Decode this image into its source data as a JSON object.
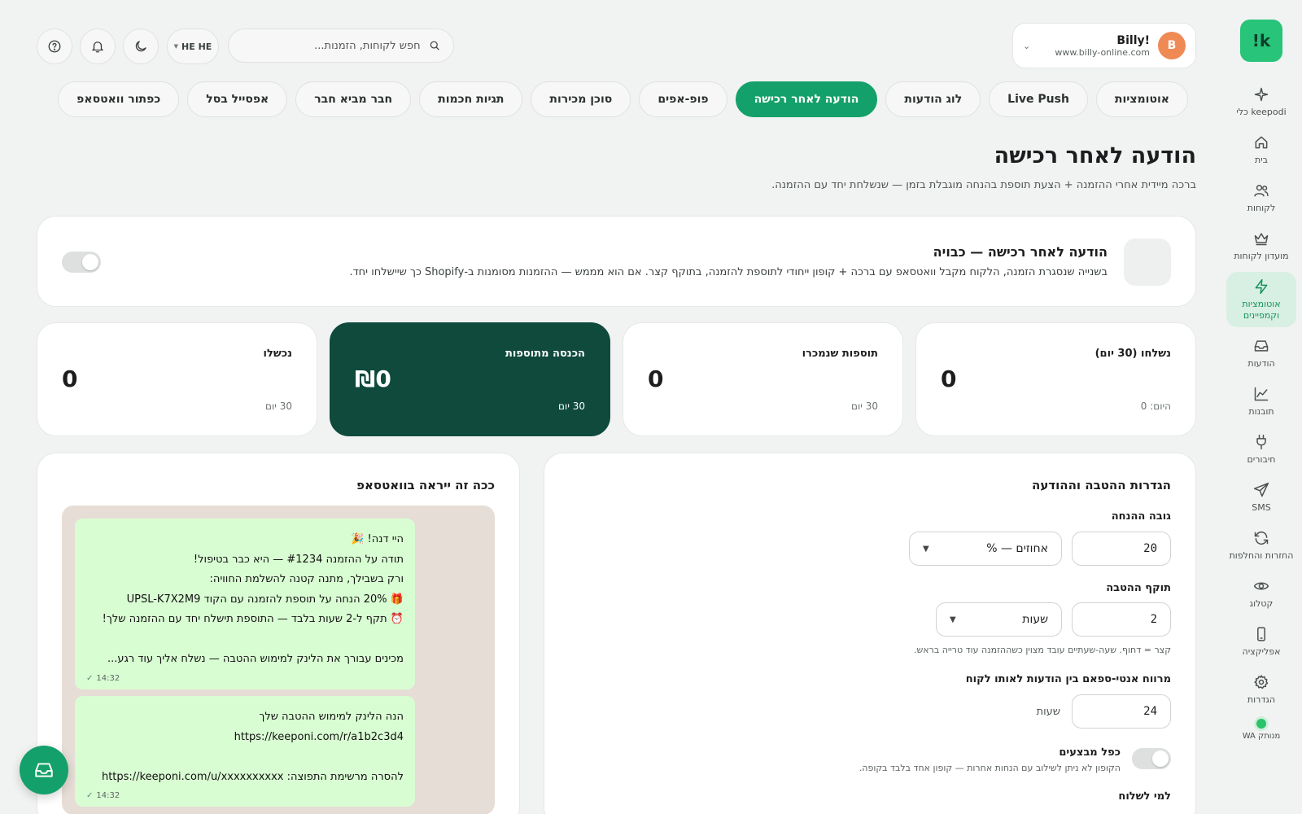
{
  "brand": {
    "logo_text": "!k",
    "accent": "#14a06a",
    "dark_card": "#0f4a3c"
  },
  "store": {
    "avatar": "B",
    "name": "Billy!",
    "url": "www.billy-online.com"
  },
  "search": {
    "placeholder": "חפש לקוחות, הזמנות..."
  },
  "lang": {
    "label": "HE HE"
  },
  "sidebar": {
    "items": [
      {
        "label": "כלי keepodi",
        "icon": "sparkle-icon"
      },
      {
        "label": "בית",
        "icon": "home-icon"
      },
      {
        "label": "לקוחות",
        "icon": "users-icon"
      },
      {
        "label": "מועדון לקוחות",
        "icon": "crown-icon"
      },
      {
        "label": "אוטומציות וקמפיינים",
        "icon": "bolt-icon",
        "active": true
      },
      {
        "label": "הודעות",
        "icon": "inbox-icon"
      },
      {
        "label": "תובנות",
        "icon": "chart-icon"
      },
      {
        "label": "חיבורים",
        "icon": "plug-icon"
      },
      {
        "label": "SMS",
        "icon": "send-icon"
      },
      {
        "label": "החזרות והחלפות",
        "icon": "refresh-icon"
      },
      {
        "label": "קטלוג",
        "icon": "eye-icon"
      },
      {
        "label": "אפליקציה",
        "icon": "phone-icon"
      },
      {
        "label": "הגדרות",
        "icon": "gear-icon"
      }
    ],
    "wa_status": "WA מנותק"
  },
  "tabs": [
    {
      "label": "אוטומציות"
    },
    {
      "label": "Live Push"
    },
    {
      "label": "לוג הודעות"
    },
    {
      "label": "הודעה לאחר רכישה",
      "active": true
    },
    {
      "label": "פופ-אפים"
    },
    {
      "label": "סוכן מכירות"
    },
    {
      "label": "תגיות חכמות"
    },
    {
      "label": "חבר מביא חבר"
    },
    {
      "label": "אפסייל בסל"
    },
    {
      "label": "כפתור וואטסאפ"
    }
  ],
  "page": {
    "title": "הודעה לאחר רכישה",
    "subtitle": "ברכה מיידית אחרי ההזמנה + הצעת תוספת בהנחה מוגבלת בזמן — שנשלחת יחד עם ההזמנה."
  },
  "feature": {
    "title": "הודעה לאחר רכישה — כבויה",
    "description": "בשנייה שנסגרת הזמנה, הלקוח מקבל וואטסאפ עם ברכה + קופון ייחודי לתוספת להזמנה, בתוקף קצר. אם הוא מממש — ההזמנות מסומנות ב-Shopify כך שיישלחו יחד.",
    "enabled": false
  },
  "stats": [
    {
      "label": "נשלחו (30 יום)",
      "value": "0",
      "foot": "היום: 0"
    },
    {
      "label": "תוספות שנמכרו",
      "value": "0",
      "foot": "30 יום"
    },
    {
      "label": "הכנסה מתוספות",
      "value": "₪0",
      "foot": "30 יום"
    },
    {
      "label": "נכשלו",
      "value": "0",
      "foot": "30 יום"
    }
  ],
  "settings": {
    "title": "הגדרות ההטבה וההודעה",
    "discount_label": "גובה ההנחה",
    "discount_value": "20",
    "discount_type": "% — אחוזים",
    "validity_label": "תוקף ההטבה",
    "validity_value": "2",
    "validity_unit": "שעות",
    "validity_hint": "קצר = דחוף. שעה-שעתיים עובד מצוין כשההזמנה עוד טרייה בראש.",
    "antispam_label": "מרווח אנטי-ספאם בין הודעות לאותו לקוח",
    "antispam_value": "24",
    "antispam_unit": "שעות",
    "combo_label": "כפל מבצעים",
    "combo_desc": "הקופון לא ניתן לשילוב עם הנחות אחרות — קופון אחד בלבד בקופה.",
    "combo_enabled": false,
    "send_to_label": "למי לשלוח"
  },
  "preview": {
    "title": "ככה זה ייראה בוואטסאפ",
    "bubble1": [
      "היי דנה! 🎉",
      "תודה על ההזמנה #1234 — היא כבר בטיפול!",
      "ורק בשבילך, מתנה קטנה להשלמת החוויה:",
      "🎁 20% הנחה על תוספת להזמנה עם הקוד UPSL-K7X2M9",
      "⏰ תקף ל-2 שעות בלבד — התוספת תישלח יחד עם ההזמנה שלך!",
      "",
      "מכינים עבורך את הלינק למימוש ההטבה — נשלח אליך עוד רגע..."
    ],
    "bubble1_time": "14:32",
    "bubble2": [
      "הנה הלינק למימוש ההטבה שלך",
      "https://keeponi.com/r/a1b2c3d4",
      "",
      "להסרה מרשימת התפוצה: https://keeponi.com/u/xxxxxxxxxx"
    ],
    "bubble2_time": "14:32"
  }
}
